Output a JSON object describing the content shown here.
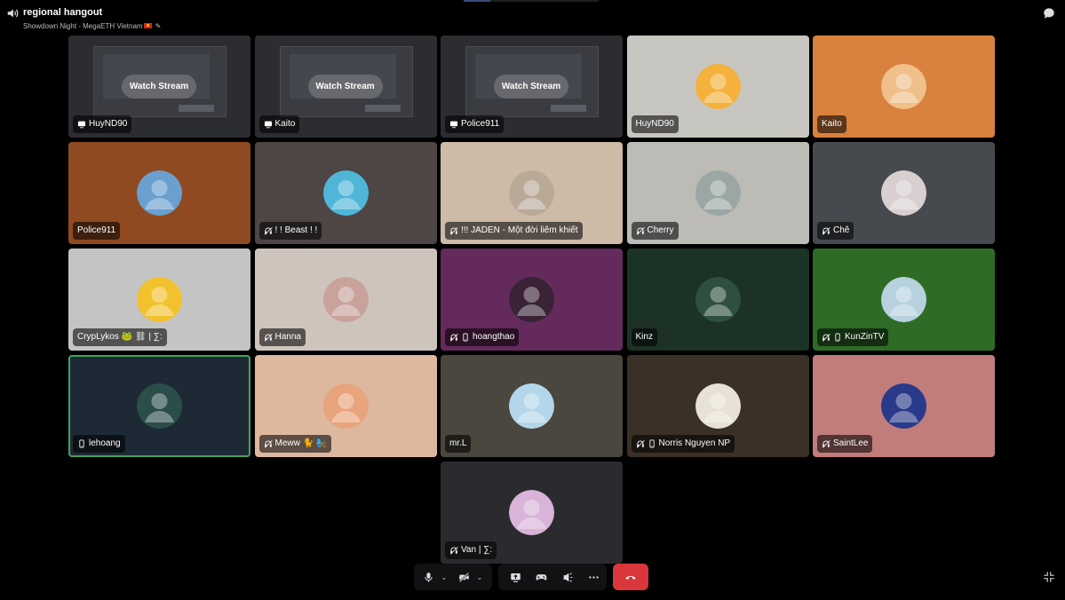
{
  "header": {
    "title": "regional hangout",
    "subtitle": "Showdown Night - MegaETH Vietnam"
  },
  "stream_button_label": "Watch Stream",
  "tiles": [
    {
      "label": "HuyND90",
      "type": "stream",
      "bg": "#2b2d31"
    },
    {
      "label": "Kaito",
      "type": "stream",
      "bg": "#2b2d31"
    },
    {
      "label": "Police911",
      "type": "stream",
      "bg": "#2b2d31"
    },
    {
      "label": "HuyND90",
      "type": "user",
      "bg": "#c8c6c0",
      "avatar_color": "#f4b13b",
      "icon": ""
    },
    {
      "label": "Kaito",
      "type": "user",
      "bg": "#d9813e",
      "avatar_color": "#f0c08a",
      "icon": ""
    },
    {
      "label": "Police911",
      "type": "user",
      "bg": "#8f4a21",
      "avatar_color": "#6a9fd0",
      "icon": ""
    },
    {
      "label": "! ! Beast ! !",
      "type": "user",
      "bg": "#4e4545",
      "avatar_color": "#4fb6d8",
      "icon": "deaf"
    },
    {
      "label": "!!! JADEN - Một đời liêm khiết",
      "type": "user",
      "bg": "#cdbba8",
      "avatar_color": "#b9aa98",
      "icon": "deaf"
    },
    {
      "label": "Cherry",
      "type": "user",
      "bg": "#bdbbb6",
      "avatar_color": "#9aa7a5",
      "icon": "deaf"
    },
    {
      "label": "Chê",
      "type": "user",
      "bg": "#464a4e",
      "avatar_color": "#d8cfd0",
      "icon": "deaf"
    },
    {
      "label": "CrypLykos 🐸 ⛓ | ∑:",
      "type": "user",
      "bg": "#c4c4c4",
      "avatar_color": "#f2c12e",
      "icon": ""
    },
    {
      "label": "Hanna",
      "type": "user",
      "bg": "#cfc4bb",
      "avatar_color": "#c8a29b",
      "icon": "deaf"
    },
    {
      "label": "hoangthao",
      "type": "user",
      "bg": "#642a5c",
      "avatar_color": "#3a2237",
      "icon": "deaf-mobile"
    },
    {
      "label": "Kinz",
      "type": "user",
      "bg": "#1c3226",
      "avatar_color": "#2f4f3f",
      "icon": ""
    },
    {
      "label": "KunZinTV",
      "type": "user",
      "bg": "#2e6c26",
      "avatar_color": "#b7d2de",
      "icon": "deaf-mobile"
    },
    {
      "label": "lehoang",
      "type": "user",
      "bg": "#1d2a35",
      "avatar_color": "#2a4e4a",
      "icon": "mobile",
      "active": true
    },
    {
      "label": "Meww 🐈 🧞",
      "type": "user",
      "bg": "#ddb89f",
      "avatar_color": "#e8a47b",
      "icon": "deaf"
    },
    {
      "label": "mr.L",
      "type": "user",
      "bg": "#4a473e",
      "avatar_color": "#b3d6ea",
      "icon": ""
    },
    {
      "label": "Norris Nguyen NP",
      "type": "user",
      "bg": "#3b3026",
      "avatar_color": "#e7e2d5",
      "icon": "deaf-mobile"
    },
    {
      "label": "SaintLee",
      "type": "user",
      "bg": "#c07d7c",
      "avatar_color": "#2a3a8a",
      "icon": "deaf"
    },
    {
      "label": "Van | ∑:",
      "type": "user",
      "bg": "#2b2a2e",
      "avatar_color": "#d8b4d8",
      "icon": "deaf"
    }
  ],
  "colors": {
    "background": "#000000",
    "hangup": "#da373c",
    "active_speaker": "#43a25a"
  }
}
